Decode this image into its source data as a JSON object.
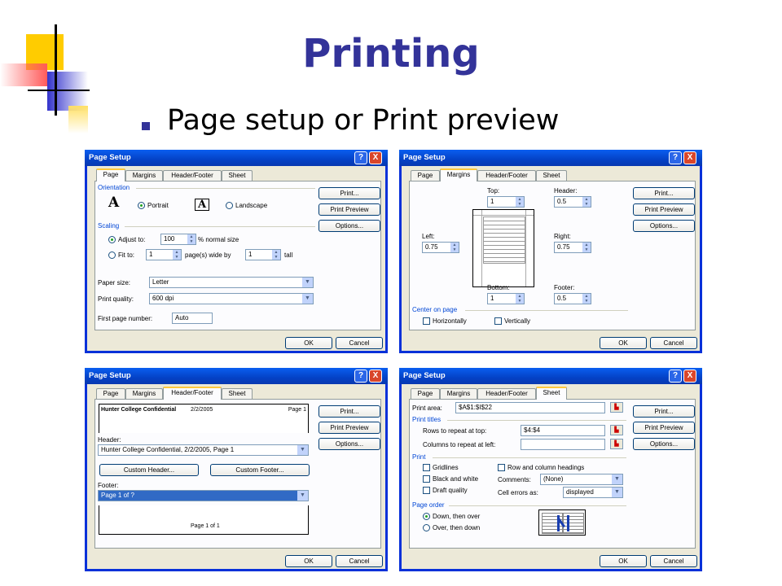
{
  "slide": {
    "title": "Printing",
    "bullet": "Page setup or Print preview"
  },
  "dialog_title": "Page Setup",
  "title_buttons": {
    "help": "?",
    "close": "X"
  },
  "tabs": [
    "Page",
    "Margins",
    "Header/Footer",
    "Sheet"
  ],
  "buttons": {
    "print": "Print...",
    "print_preview": "Print Preview",
    "options": "Options...",
    "ok": "OK",
    "cancel": "Cancel"
  },
  "page": {
    "orientation_label": "Orientation",
    "portrait": "Portrait",
    "landscape": "Landscape",
    "scaling_label": "Scaling",
    "adjust_to": "Adjust to:",
    "adjust_value": "100",
    "normal_size": "% normal size",
    "fit_to": "Fit to:",
    "fit_wide": "1",
    "pages_wide": "page(s) wide by",
    "fit_tall": "1",
    "tall": "tall",
    "paper_size_label": "Paper size:",
    "paper_size": "Letter",
    "print_quality_label": "Print quality:",
    "print_quality": "600 dpi",
    "first_page_label": "First page number:",
    "first_page": "Auto"
  },
  "margins": {
    "top_label": "Top:",
    "top": "1",
    "header_label": "Header:",
    "header": "0.5",
    "left_label": "Left:",
    "left": "0.75",
    "right_label": "Right:",
    "right": "0.75",
    "bottom_label": "Bottom:",
    "bottom": "1",
    "footer_label": "Footer:",
    "footer": "0.5",
    "center_label": "Center on page",
    "horizontally": "Horizontally",
    "vertically": "Vertically"
  },
  "header_footer": {
    "preview_left": "Hunter College Confidential",
    "preview_mid": "2/2/2005",
    "preview_right": "Page 1",
    "header_label": "Header:",
    "header_value": "Hunter College Confidential, 2/2/2005, Page 1",
    "custom_header": "Custom Header...",
    "custom_footer": "Custom Footer...",
    "footer_label": "Footer:",
    "footer_value": "Page 1 of ?",
    "footer_preview": "Page 1 of 1"
  },
  "sheet": {
    "print_area_label": "Print area:",
    "print_area": "$A$1:$I$22",
    "print_titles_label": "Print titles",
    "rows_label": "Rows to repeat at top:",
    "rows_value": "$4:$4",
    "cols_label": "Columns to repeat at left:",
    "cols_value": "",
    "print_label": "Print",
    "gridlines": "Gridlines",
    "black_white": "Black and white",
    "draft": "Draft quality",
    "row_col_headings": "Row and column headings",
    "comments_label": "Comments:",
    "comments": "(None)",
    "cell_errors_label": "Cell errors as:",
    "cell_errors": "displayed",
    "page_order_label": "Page order",
    "down_over": "Down, then over",
    "over_down": "Over, then down"
  }
}
